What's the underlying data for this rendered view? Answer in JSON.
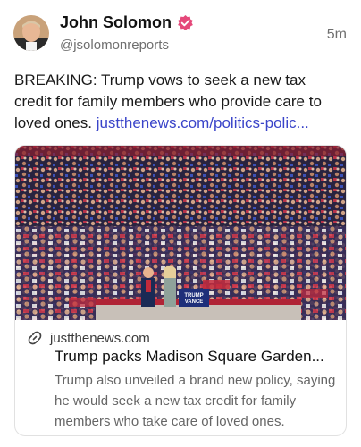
{
  "post": {
    "author_name": "John Solomon",
    "handle": "@jsolomonreports",
    "time": "5m",
    "text": "BREAKING: Trump vows to seek a new tax credit for family members who provide care to loved ones. ",
    "link_text": "justthenews.com/politics-polic...",
    "verified_color": "#e5487a",
    "link_color": "#3a44c9"
  },
  "card": {
    "domain": "justthenews.com",
    "title": "Trump packs Madison Square Garden...",
    "description": "Trump also unveiled a brand new policy, saying he would seek a new tax credit for family members who take care of loved ones."
  },
  "image": {
    "podium_sign_line1": "TRUMP",
    "podium_sign_line2": "VANCE"
  }
}
